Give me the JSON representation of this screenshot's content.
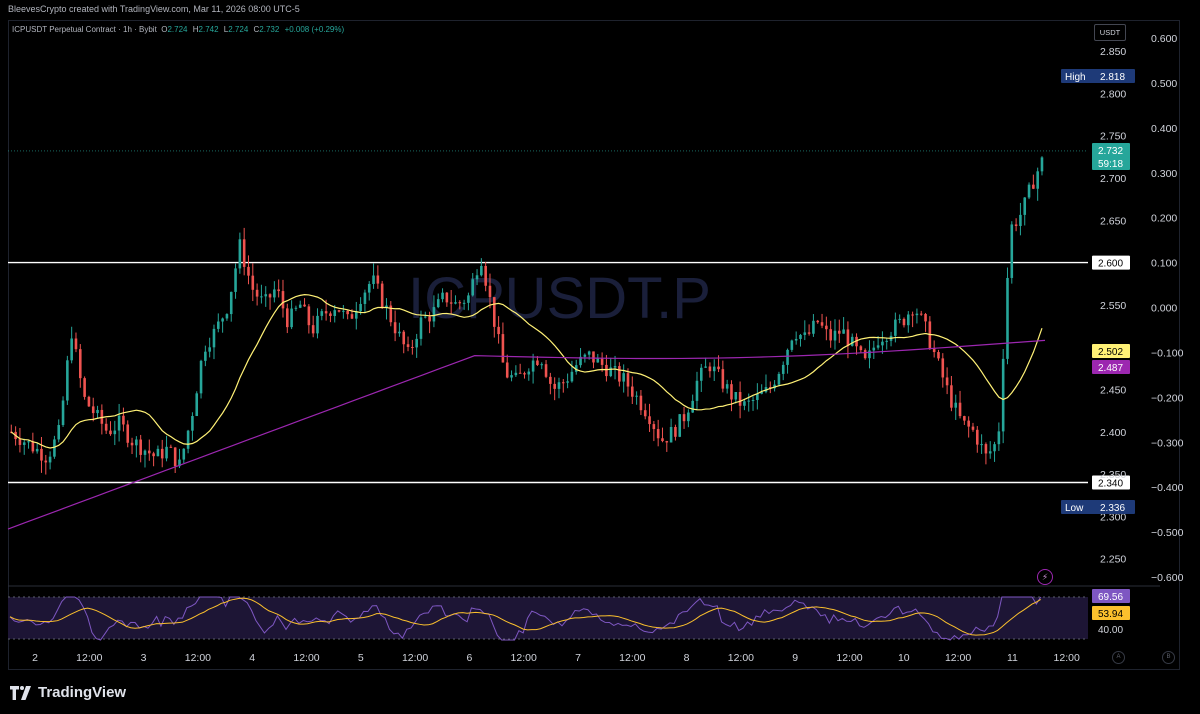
{
  "header": {
    "watermark_credit": "BleevesCrypto created with TradingView.com, Mar 11, 2026 08:00 UTC-5"
  },
  "legend": {
    "symbol": "ICPUSDT Perpetual Contract · 1h · Bybit",
    "o_label": "O",
    "o": "2.724",
    "h_label": "H",
    "h": "2.742",
    "l_label": "L",
    "l": "2.724",
    "c_label": "C",
    "c": "2.732",
    "change": "+0.008 (+0.29%)"
  },
  "watermark_symbol": "ICPUSDT.P",
  "currency_label": "USDT",
  "footer": {
    "brand": "TradingView"
  },
  "axis_buttons": {
    "a": "A",
    "b": "B"
  },
  "colors": {
    "up": "#26a69a",
    "down": "#ef5350",
    "ma_fast": "#fff176",
    "ma_slow": "#9c27b0",
    "rsi": "#7e57c2",
    "rsi_ma": "#fbc02d",
    "level": "#ffffff"
  },
  "chart_data": {
    "type": "candlestick",
    "price_axis": {
      "ylim": [
        2.22,
        2.875
      ],
      "ticks": [
        "2.850",
        "2.800",
        "2.750",
        "2.700",
        "2.650",
        "2.550",
        "2.500",
        "2.450",
        "2.400",
        "2.350",
        "2.300",
        "2.250"
      ]
    },
    "percent_axis": {
      "ticks": [
        "0.600",
        "0.500",
        "0.400",
        "0.300",
        "0.200",
        "0.100",
        "0.000",
        "−0.100",
        "−0.200",
        "−0.300",
        "−0.400",
        "−0.500",
        "−0.600"
      ]
    },
    "x_ticks": [
      "2",
      "12:00",
      "3",
      "12:00",
      "4",
      "12:00",
      "5",
      "12:00",
      "6",
      "12:00",
      "7",
      "12:00",
      "8",
      "12:00",
      "9",
      "12:00",
      "10",
      "12:00",
      "11",
      "12:00"
    ],
    "horizontal_levels": [
      {
        "label": "2.600",
        "value": 2.6
      },
      {
        "label": "2.340",
        "value": 2.34
      }
    ],
    "high": {
      "label": "High",
      "value": "2.818"
    },
    "low": {
      "label": "Low",
      "value": "2.336"
    },
    "last_price": {
      "value": "2.732",
      "countdown": "59:18"
    },
    "ma_fast_last": "2.502",
    "ma_slow_last": "2.487",
    "price_path": [
      [
        0,
        2.4
      ],
      [
        1,
        2.39
      ],
      [
        2,
        2.38
      ],
      [
        3,
        2.37
      ],
      [
        4,
        2.4
      ],
      [
        5,
        2.52
      ],
      [
        6,
        2.44
      ],
      [
        7,
        2.42
      ],
      [
        8,
        2.4
      ],
      [
        9,
        2.41
      ],
      [
        10,
        2.39
      ],
      [
        11,
        2.38
      ],
      [
        12,
        2.37
      ],
      [
        13,
        2.38
      ],
      [
        14,
        2.36
      ],
      [
        15,
        2.42
      ],
      [
        16,
        2.5
      ],
      [
        17,
        2.52
      ],
      [
        18,
        2.55
      ],
      [
        19,
        2.62
      ],
      [
        20,
        2.57
      ],
      [
        21,
        2.55
      ],
      [
        22,
        2.57
      ],
      [
        23,
        2.53
      ],
      [
        24,
        2.55
      ],
      [
        25,
        2.52
      ],
      [
        26,
        2.54
      ],
      [
        27,
        2.55
      ],
      [
        28,
        2.53
      ],
      [
        29,
        2.56
      ],
      [
        30,
        2.58
      ],
      [
        31,
        2.55
      ],
      [
        32,
        2.52
      ],
      [
        33,
        2.49
      ],
      [
        34,
        2.53
      ],
      [
        35,
        2.54
      ],
      [
        36,
        2.56
      ],
      [
        37,
        2.55
      ],
      [
        38,
        2.56
      ],
      [
        39,
        2.61
      ],
      [
        40,
        2.54
      ],
      [
        41,
        2.47
      ],
      [
        42,
        2.46
      ],
      [
        43,
        2.48
      ],
      [
        44,
        2.49
      ],
      [
        45,
        2.45
      ],
      [
        46,
        2.46
      ],
      [
        47,
        2.48
      ],
      [
        48,
        2.49
      ],
      [
        49,
        2.48
      ],
      [
        50,
        2.47
      ],
      [
        51,
        2.46
      ],
      [
        52,
        2.44
      ],
      [
        53,
        2.42
      ],
      [
        54,
        2.39
      ],
      [
        55,
        2.4
      ],
      [
        56,
        2.42
      ],
      [
        57,
        2.46
      ],
      [
        58,
        2.48
      ],
      [
        59,
        2.46
      ],
      [
        60,
        2.44
      ],
      [
        61,
        2.43
      ],
      [
        62,
        2.44
      ],
      [
        63,
        2.45
      ],
      [
        64,
        2.48
      ],
      [
        65,
        2.52
      ],
      [
        66,
        2.51
      ],
      [
        67,
        2.53
      ],
      [
        68,
        2.51
      ],
      [
        69,
        2.52
      ],
      [
        70,
        2.5
      ],
      [
        71,
        2.48
      ],
      [
        72,
        2.51
      ],
      [
        73,
        2.52
      ],
      [
        74,
        2.53
      ],
      [
        75,
        2.55
      ],
      [
        76,
        2.52
      ],
      [
        77,
        2.48
      ],
      [
        78,
        2.44
      ],
      [
        79,
        2.41
      ],
      [
        80,
        2.4
      ],
      [
        81,
        2.37
      ],
      [
        82,
        2.39
      ],
      [
        83,
        2.64
      ],
      [
        84,
        2.66
      ],
      [
        85,
        2.7
      ],
      [
        86,
        2.73
      ]
    ],
    "rsi": {
      "last": "69.56",
      "ma_last": "53.94",
      "level_label": "40.00"
    }
  }
}
